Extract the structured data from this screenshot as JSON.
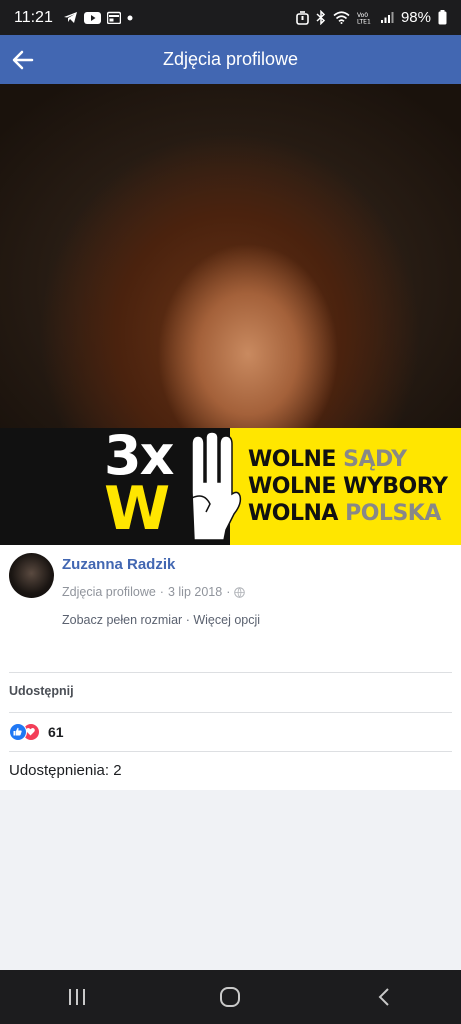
{
  "status_bar": {
    "time": "11:21",
    "battery": "98%",
    "left_icons": [
      "telegram-icon",
      "youtube-icon",
      "calendar-icon",
      "dot-icon"
    ],
    "right_icons": [
      "alarm-icon",
      "bluetooth-icon",
      "wifi-icon",
      "volte-icon",
      "signal-icon",
      "battery-icon"
    ]
  },
  "app_bar": {
    "title": "Zdjęcia profilowe"
  },
  "photo": {
    "banner": {
      "number": "3x",
      "letter": "W",
      "lines": [
        {
          "part1": "WOLNE ",
          "part2": "SĄDY"
        },
        {
          "part1": "WOLNE WYBORY",
          "part2": ""
        },
        {
          "part1": "WOLNA ",
          "part2": "POLSKA"
        }
      ]
    }
  },
  "post": {
    "author": "Zuzanna Radzik",
    "album": "Zdjęcia profilowe",
    "date": "3 lip 2018",
    "dot": "·",
    "full_size_link": "Zobacz pełen rozmiar",
    "more_options_link": "Więcej opcji",
    "share_label": "Udostępnij",
    "reaction_count": "61",
    "shares_text": "Udostępnienia: 2"
  },
  "colors": {
    "app_bar": "#4267b2",
    "banner_yellow": "#ffe600",
    "like": "#2078f4",
    "love": "#f33e58"
  }
}
